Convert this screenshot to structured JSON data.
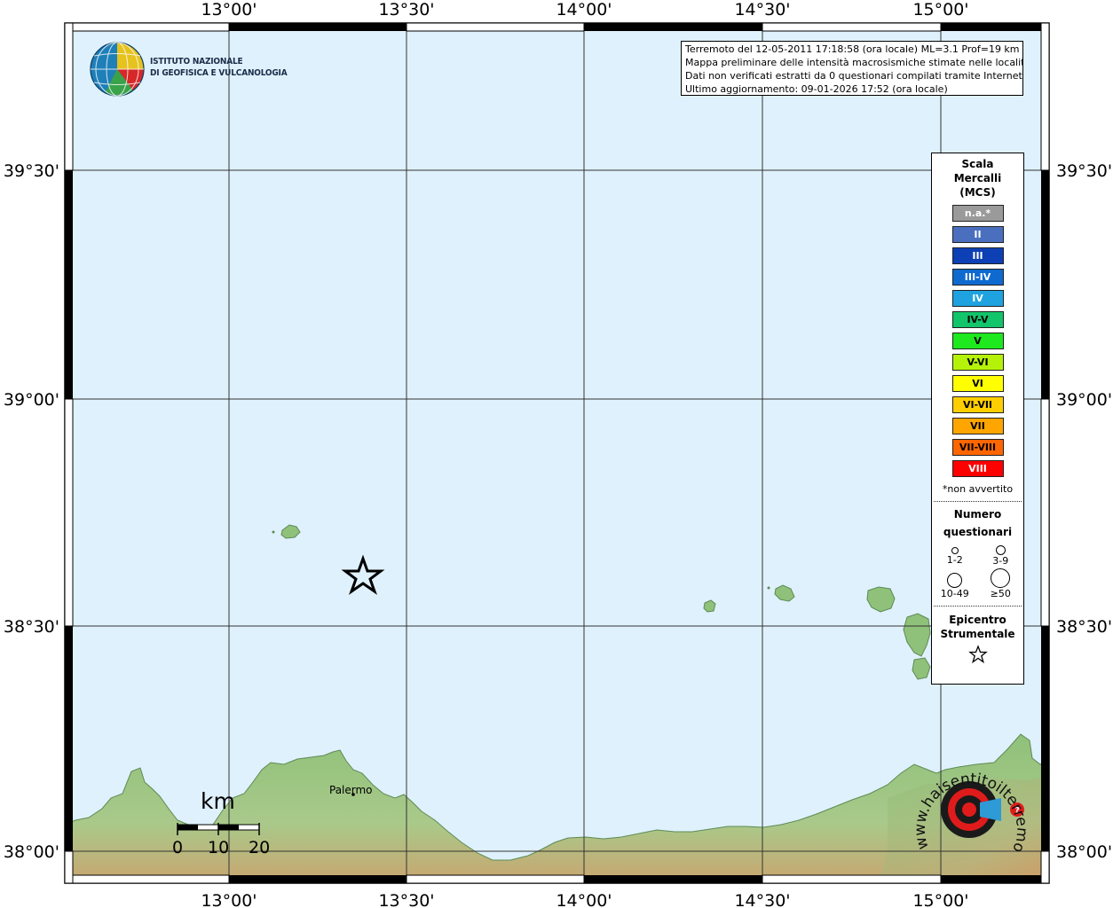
{
  "map": {
    "top_ticks": [
      "13°00'",
      "13°30'",
      "14°00'",
      "14°30'",
      "15°00'"
    ],
    "bottom_ticks": [
      "13°00'",
      "13°30'",
      "14°00'",
      "14°30'",
      "15°00'"
    ],
    "left_ticks": [
      "39°30'",
      "39°00'",
      "38°30'",
      "38°00'"
    ],
    "right_ticks": [
      "39°30'",
      "39°00'",
      "38°30'",
      "38°00'"
    ],
    "colors": {
      "sea": "#dff1fc",
      "land_low": "#8fc17a",
      "land_high": "#c9a56f",
      "grid": "#333333"
    }
  },
  "institute": {
    "line1": "ISTITUTO NAZIONALE",
    "line2": "DI GEOFISICA E VULCANOLOGIA"
  },
  "info": {
    "line1": "Terremoto del 12-05-2011 17:18:58 (ora locale) ML=3.1 Prof=19 km",
    "line2": "Mappa preliminare delle intensità macrosismiche stimate nelle località",
    "line3": "Dati non verificati estratti da 0 questionari compilati tramite Internet.",
    "line4": "Ultimo aggiornamento: 09-01-2026 17:52 (ora locale)"
  },
  "legend": {
    "title1": "Scala",
    "title2": "Mercalli",
    "title3": "(MCS)",
    "mcs": [
      {
        "label": "n.a.*",
        "color": "#9a9a9a",
        "text": "#ffffff"
      },
      {
        "label": "II",
        "color": "#4a6fbf",
        "text": "#ffffff"
      },
      {
        "label": "III",
        "color": "#0d3fb5",
        "text": "#ffffff"
      },
      {
        "label": "III-IV",
        "color": "#0f6ad0",
        "text": "#ffffff"
      },
      {
        "label": "IV",
        "color": "#1ea3e0",
        "text": "#ffffff"
      },
      {
        "label": "IV-V",
        "color": "#12c46a",
        "text": "#000000"
      },
      {
        "label": "V",
        "color": "#1ee81e",
        "text": "#000000"
      },
      {
        "label": "V-VI",
        "color": "#b5f20a",
        "text": "#000000"
      },
      {
        "label": "VI",
        "color": "#ffff00",
        "text": "#000000"
      },
      {
        "label": "VI-VII",
        "color": "#ffce00",
        "text": "#000000"
      },
      {
        "label": "VII",
        "color": "#ffa500",
        "text": "#000000"
      },
      {
        "label": "VII-VIII",
        "color": "#ff6600",
        "text": "#000000"
      },
      {
        "label": "VIII",
        "color": "#ff0000",
        "text": "#ffffff"
      }
    ],
    "footnote": "*non avvertito",
    "questionnaires_title1": "Numero",
    "questionnaires_title2": "questionari",
    "q_labels": [
      "1-2",
      "3-9",
      "10-49",
      "≥50"
    ],
    "epicenter_title1": "Epicentro",
    "epicenter_title2": "Strumentale"
  },
  "places": {
    "city": "Palermo"
  },
  "scale_bar": {
    "unit": "km",
    "ticks": [
      "0",
      "10",
      "20"
    ]
  },
  "watermark": {
    "text": "www.haisentitoilterremoto.it"
  }
}
